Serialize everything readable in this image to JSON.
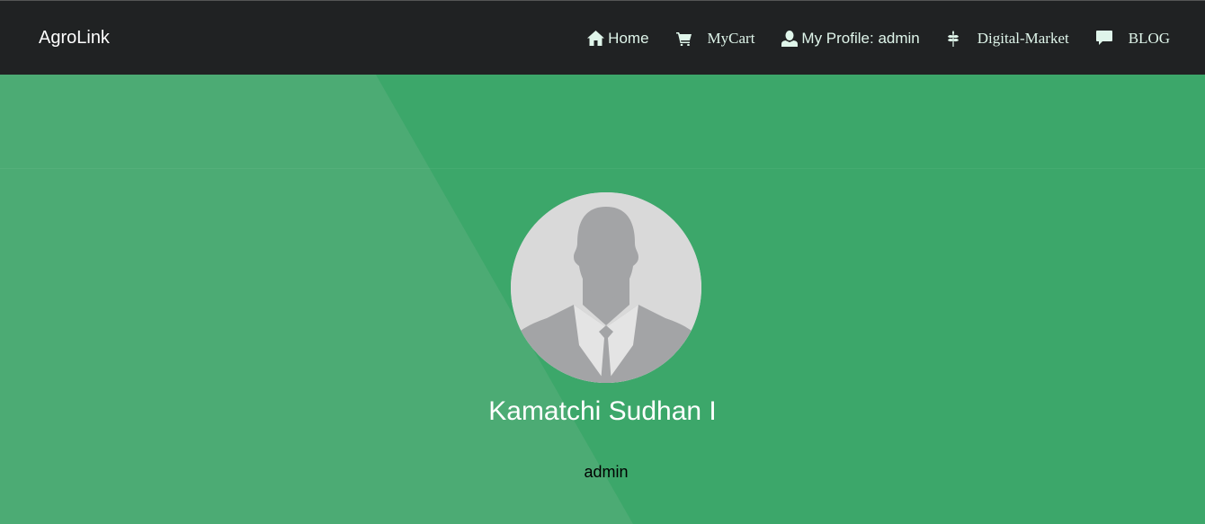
{
  "navbar": {
    "brand": "AgroLink",
    "items": [
      {
        "label": "Home",
        "icon": "home-icon"
      },
      {
        "label": "MyCart",
        "icon": "cart-icon"
      },
      {
        "label": "My Profile: admin",
        "icon": "user-icon"
      },
      {
        "label": "Digital-Market",
        "icon": "leaf-icon"
      },
      {
        "label": "BLOG",
        "icon": "comment-icon"
      }
    ]
  },
  "profile": {
    "name": "Kamatchi Sudhan I",
    "role": "admin",
    "avatar_icon": "avatar-placeholder-icon"
  },
  "colors": {
    "navbar_bg": "#202223",
    "hero_bg": "#3ca76a",
    "hero_diagonal": "#4cab74",
    "nav_text": "#dff5ea"
  }
}
